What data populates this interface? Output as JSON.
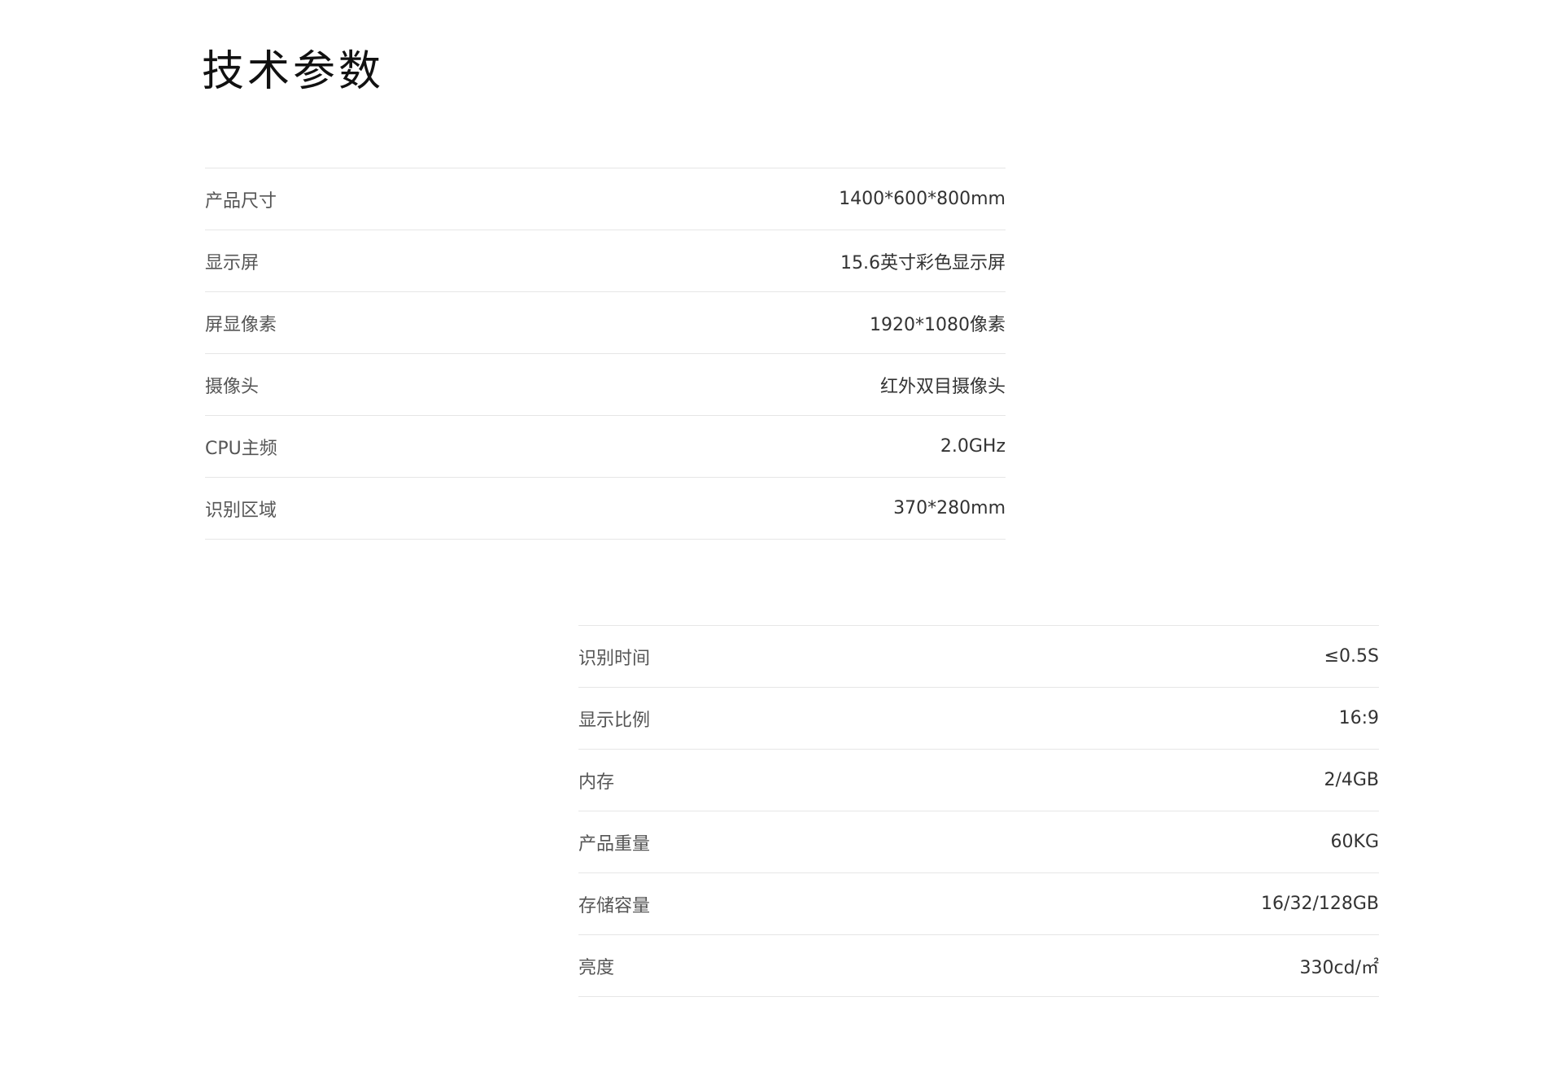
{
  "page": {
    "title": "技术参数"
  },
  "specs_left": [
    {
      "label": "产品尺寸",
      "value": "1400*600*800mm"
    },
    {
      "label": "显示屏",
      "value": "15.6英寸彩色显示屏"
    },
    {
      "label": "屏显像素",
      "value": "1920*1080像素"
    },
    {
      "label": "摄像头",
      "value": "红外双目摄像头"
    },
    {
      "label": "CPU主频",
      "value": "2.0GHz"
    },
    {
      "label": "识别区域",
      "value": "370*280mm"
    }
  ],
  "specs_right": [
    {
      "label": "识别时间",
      "value": "≤0.5S"
    },
    {
      "label": "显示比例",
      "value": "16:9"
    },
    {
      "label": "内存",
      "value": "2/4GB"
    },
    {
      "label": "产品重量",
      "value": "60KG"
    },
    {
      "label": "存储容量",
      "value": "16/32/128GB"
    },
    {
      "label": "亮度",
      "value": "330cd/㎡"
    }
  ]
}
